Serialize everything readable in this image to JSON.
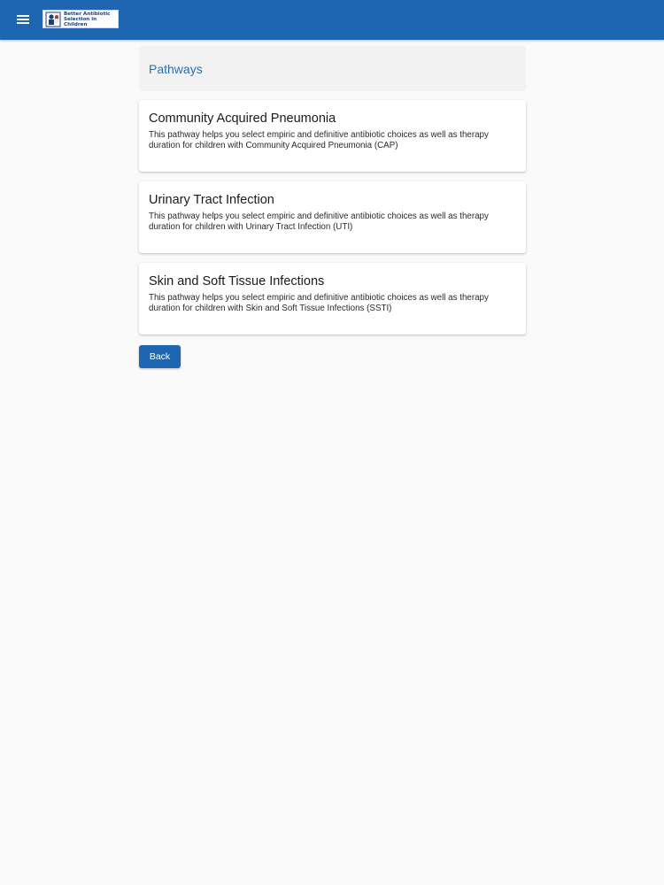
{
  "app": {
    "logo_text": "Better Antibiotic\nSelection in\nChildren",
    "menu_icon": "menu-icon",
    "colors": {
      "primary": "#1e66b1",
      "header_text": "#2c6db0",
      "background": "#fafafa"
    }
  },
  "page": {
    "title": "Pathways"
  },
  "pathways": [
    {
      "title": "Community Acquired Pneumonia",
      "description": "This pathway helps you select empiric and definitive antibiotic choices as well as therapy duration for children with Community Acquired Pneumonia (CAP)"
    },
    {
      "title": "Urinary Tract Infection",
      "description": "This pathway helps you select empiric and definitive antibiotic choices as well as therapy duration for children with Urinary Tract Infection (UTI)"
    },
    {
      "title": "Skin and Soft Tissue Infections",
      "description": "This pathway helps you select empiric and definitive antibiotic choices as well as therapy duration for children with Skin and Soft Tissue Infections (SSTI)"
    }
  ],
  "actions": {
    "back_label": "Back"
  }
}
